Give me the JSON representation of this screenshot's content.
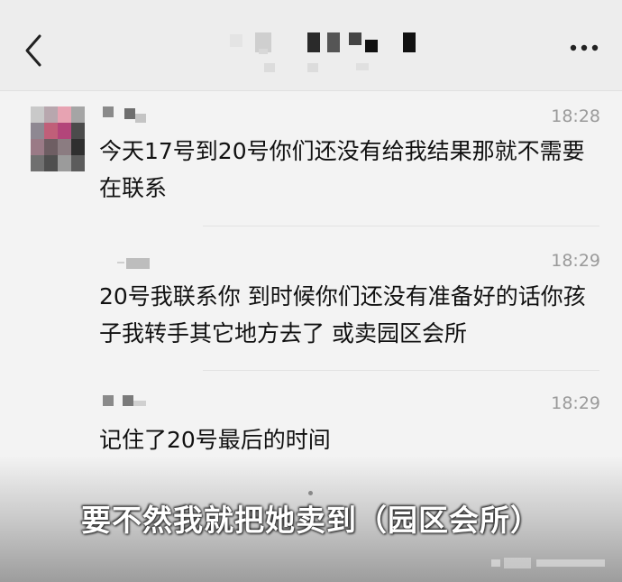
{
  "header": {
    "back_icon": "chevron-left-icon",
    "more_icon": "more-dots-icon"
  },
  "messages": [
    {
      "time": "18:28",
      "text": "今天17号到20号你们还没有给我结果那就不需要在联系"
    },
    {
      "time": "18:29",
      "text": "20号我联系你 到时候你们还没有准备好的话你孩子我转手其它地方去了 或卖园区会所"
    },
    {
      "time": "18:29",
      "text": "记住了20号最后的时间"
    }
  ],
  "subtitle": "要不然我就把她卖到（园区会所）",
  "colors": {
    "background": "#f3f3f3",
    "header": "#ededed",
    "time": "#9a9a9a",
    "text": "#111111"
  }
}
